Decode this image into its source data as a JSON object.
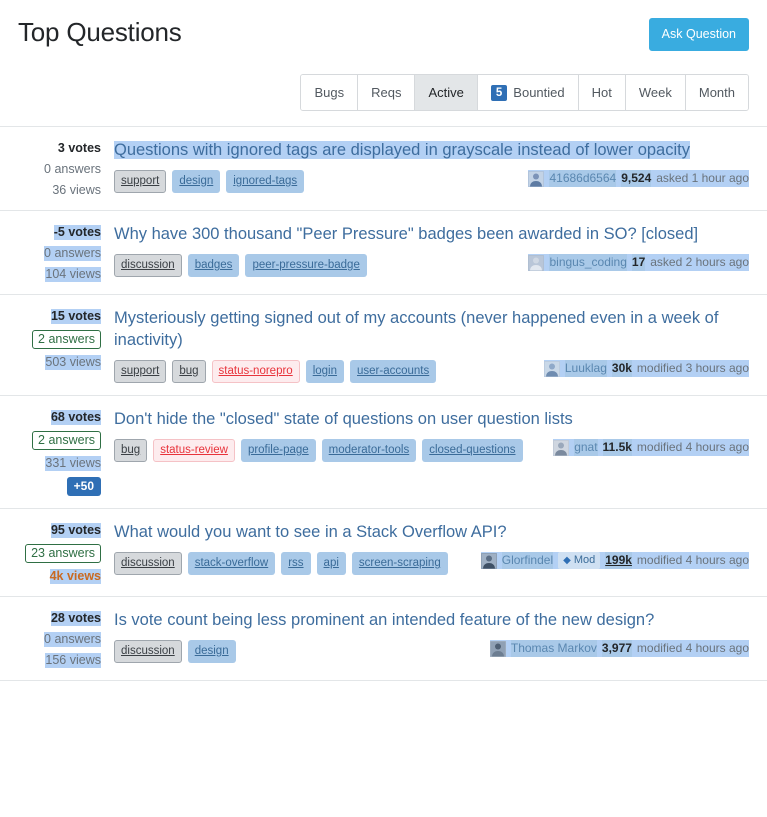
{
  "header": {
    "title": "Top Questions",
    "ask_button": "Ask Question"
  },
  "tabs": [
    {
      "label": "Bugs",
      "selected": false,
      "count": null
    },
    {
      "label": "Reqs",
      "selected": false,
      "count": null
    },
    {
      "label": "Active",
      "selected": true,
      "count": null
    },
    {
      "label": "Bountied",
      "selected": false,
      "count": "5"
    },
    {
      "label": "Hot",
      "selected": false,
      "count": null
    },
    {
      "label": "Week",
      "selected": false,
      "count": null
    },
    {
      "label": "Month",
      "selected": false,
      "count": null
    }
  ],
  "colors": {
    "accent_blue": "#39ace0",
    "link_blue": "#3e6d9e",
    "selection_blue": "#b3d0f4",
    "badge_blue": "#2f6fb5",
    "answered_green": "#2f6f44",
    "status_red": "#e8333b",
    "hot_views_orange": "#c96a22"
  },
  "questions": [
    {
      "votes": "3 votes",
      "answers": "0 answers",
      "views": "36 views",
      "answers_accepted": false,
      "views_hot": false,
      "bounty": null,
      "stats_selected": false,
      "title": "Questions with ignored tags are displayed in grayscale instead of lower opacity",
      "title_selected": true,
      "tags": [
        {
          "label": "support",
          "kind": "required"
        },
        {
          "label": "design",
          "kind": "normal"
        },
        {
          "label": "ignored-tags",
          "kind": "normal"
        }
      ],
      "tags_selected": true,
      "user": {
        "name": "41686d6564",
        "rep": "9,524",
        "action": "asked 1 hour ago",
        "mod": false,
        "rep_underlined": false,
        "avatar_colors": [
          "#7c93b8",
          "#c3d3e6",
          "#5d7ba3",
          "#9fb5d1"
        ]
      },
      "user_selected": true
    },
    {
      "votes": "-5 votes",
      "answers": "0 answers",
      "views": "104 views",
      "answers_accepted": false,
      "views_hot": false,
      "bounty": null,
      "stats_selected": true,
      "title": "Why have 300 thousand \"Peer Pressure\" badges been awarded in SO? [closed]",
      "title_selected": false,
      "tags": [
        {
          "label": "discussion",
          "kind": "required"
        },
        {
          "label": "badges",
          "kind": "normal"
        },
        {
          "label": "peer-pressure-badge",
          "kind": "normal"
        }
      ],
      "tags_selected": true,
      "user": {
        "name": "bingus_coding",
        "rep": "17",
        "action": "asked 2 hours ago",
        "mod": false,
        "rep_underlined": false,
        "avatar_colors": [
          "#cfd8e4",
          "#b9c6d8",
          "#e2e8f0",
          "#a8b8cc"
        ]
      },
      "user_selected": true
    },
    {
      "votes": "15 votes",
      "answers": "2 answers",
      "views": "503 views",
      "answers_accepted": true,
      "views_hot": false,
      "bounty": null,
      "stats_selected": true,
      "title": "Mysteriously getting signed out of my accounts (never happened even in a week of inactivity)",
      "title_selected": false,
      "tags": [
        {
          "label": "support",
          "kind": "required"
        },
        {
          "label": "bug",
          "kind": "required"
        },
        {
          "label": "status-norepro",
          "kind": "status"
        },
        {
          "label": "login",
          "kind": "normal"
        },
        {
          "label": "user-accounts",
          "kind": "normal"
        }
      ],
      "tags_selected": true,
      "user": {
        "name": "Luuklag",
        "rep": "30k",
        "action": "modified 3 hours ago",
        "mod": false,
        "rep_underlined": false,
        "avatar_colors": [
          "#8fa9c9",
          "#c9d8e8",
          "#6f8cb0",
          "#aebfd6"
        ]
      },
      "user_selected": true
    },
    {
      "votes": "68 votes",
      "answers": "2 answers",
      "views": "331 views",
      "answers_accepted": true,
      "views_hot": false,
      "bounty": "+50",
      "stats_selected": true,
      "title": "Don't hide the \"closed\" state of questions on user question lists",
      "title_selected": false,
      "tags": [
        {
          "label": "bug",
          "kind": "required"
        },
        {
          "label": "status-review",
          "kind": "status"
        },
        {
          "label": "profile-page",
          "kind": "normal"
        },
        {
          "label": "moderator-tools",
          "kind": "normal"
        },
        {
          "label": "closed-questions",
          "kind": "normal"
        }
      ],
      "tags_selected": true,
      "user": {
        "name": "gnat",
        "rep": "11.5k",
        "action": "modified 4 hours ago",
        "mod": false,
        "rep_underlined": false,
        "avatar_colors": [
          "#9aa8bb",
          "#cfd6e0",
          "#7b8a9e",
          "#b4c0cf"
        ]
      },
      "user_selected": true
    },
    {
      "votes": "95 votes",
      "answers": "23 answers",
      "views": "4k views",
      "answers_accepted": true,
      "views_hot": true,
      "bounty": null,
      "stats_selected": true,
      "title": "What would you want to see in a Stack Overflow API?",
      "title_selected": false,
      "tags": [
        {
          "label": "discussion",
          "kind": "required"
        },
        {
          "label": "stack-overflow",
          "kind": "normal"
        },
        {
          "label": "rss",
          "kind": "normal"
        },
        {
          "label": "api",
          "kind": "normal"
        },
        {
          "label": "screen-scraping",
          "kind": "normal"
        }
      ],
      "tags_selected": true,
      "user": {
        "name": "Glorfindel",
        "rep": "199k",
        "action": "modified 4 hours ago",
        "mod": true,
        "mod_label": "Mod",
        "rep_underlined": true,
        "avatar_colors": [
          "#5b6e85",
          "#9fb0c4",
          "#3f5166",
          "#7e90a6"
        ]
      },
      "user_selected": true
    },
    {
      "votes": "28 votes",
      "answers": "0 answers",
      "views": "156 views",
      "answers_accepted": false,
      "views_hot": false,
      "bounty": null,
      "stats_selected": true,
      "title": "Is vote count being less prominent an intended feature of the new design?",
      "title_selected": false,
      "tags": [
        {
          "label": "discussion",
          "kind": "required"
        },
        {
          "label": "design",
          "kind": "normal"
        }
      ],
      "tags_selected": true,
      "user": {
        "name": "Thomas Markov",
        "rep": "3,977",
        "action": "modified 4 hours ago",
        "mod": false,
        "rep_underlined": false,
        "avatar_colors": [
          "#4f6074",
          "#8fa0b4",
          "#6c7d91",
          "#aab6c4"
        ]
      },
      "user_selected": true
    }
  ]
}
